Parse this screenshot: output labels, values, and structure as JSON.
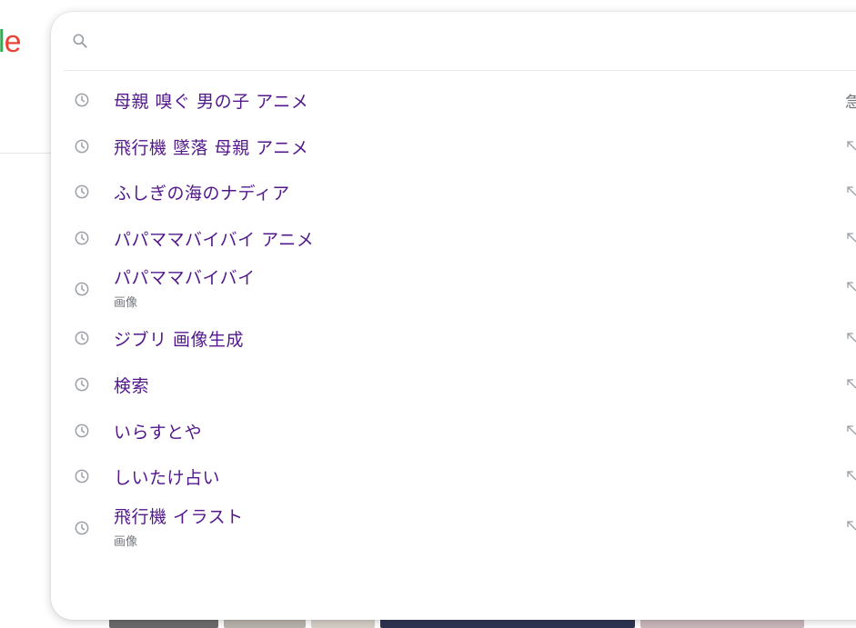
{
  "logo": {
    "partial_text_1": "l",
    "partial_text_2": "e"
  },
  "search": {
    "placeholder": "",
    "value": ""
  },
  "suggestions": [
    {
      "text": "母親 嗅ぐ 男の子 アニメ",
      "sub": "",
      "right_edge": "急"
    },
    {
      "text": "飛行機 墜落 母親 アニメ",
      "sub": ""
    },
    {
      "text": "ふしぎの海のナディア",
      "sub": ""
    },
    {
      "text": "パパママバイバイ アニメ",
      "sub": ""
    },
    {
      "text": "パパママバイバイ",
      "sub": "画像"
    },
    {
      "text": "ジブリ 画像生成",
      "sub": ""
    },
    {
      "text": "検索",
      "sub": ""
    },
    {
      "text": "いらすとや",
      "sub": ""
    },
    {
      "text": "しいたけ占い",
      "sub": ""
    },
    {
      "text": "飛行機 イラスト",
      "sub": "画像"
    }
  ],
  "colors": {
    "suggestion_text": "#52188c",
    "sub_text": "#70757a",
    "icon_gray": "#9aa0a6",
    "logo_green": "#34a853",
    "logo_red": "#ea4335"
  },
  "icons": {
    "search": "search-icon",
    "history": "history-clock-icon",
    "fill_query": "north-west-arrow-icon"
  }
}
